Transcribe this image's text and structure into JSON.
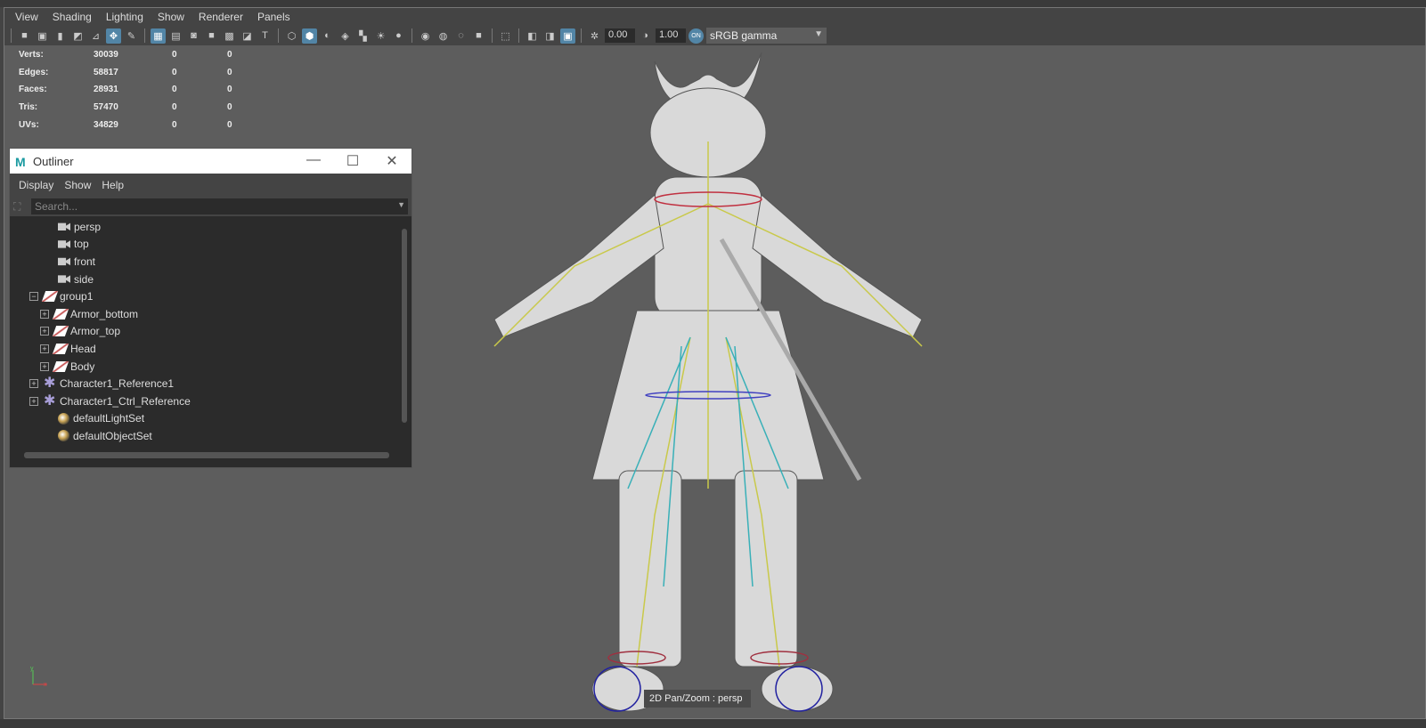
{
  "menubar": [
    "View",
    "Shading",
    "Lighting",
    "Show",
    "Renderer",
    "Panels"
  ],
  "toolbar": {
    "icons": [
      "camera-icon",
      "camera-attr-icon",
      "bookmark-icon",
      "image-plane-icon",
      "grid-snap-icon",
      "pan-zoom-icon",
      "grease-pencil-icon",
      "|",
      "grid-icon",
      "film-gate-icon",
      "resolution-gate-icon",
      "gate-mask-icon",
      "field-chart-icon",
      "safe-action-icon",
      "safe-title-icon",
      "|",
      "wireframe-icon",
      "smooth-shade-icon",
      "default-material-icon",
      "wireframe-on-shaded-icon",
      "textured-icon",
      "use-lights-icon",
      "shadows-icon",
      "|",
      "screen-space-ao-icon",
      "motion-blur-icon",
      "anti-aliasing-icon",
      "depth-of-field-icon",
      "|",
      "isolate-select-icon",
      "|",
      "xray-icon",
      "xray-joints-icon",
      "xray-active-icon",
      "|"
    ],
    "active": [
      "pan-zoom-icon",
      "grid-icon",
      "smooth-shade-icon",
      "xray-active-icon"
    ],
    "exposure": "0.00",
    "gamma": "1.00",
    "color_space": "sRGB gamma"
  },
  "stats": [
    {
      "label": "Verts:",
      "v": "30039",
      "a": "0",
      "b": "0"
    },
    {
      "label": "Edges:",
      "v": "58817",
      "a": "0",
      "b": "0"
    },
    {
      "label": "Faces:",
      "v": "28931",
      "a": "0",
      "b": "0"
    },
    {
      "label": "Tris:",
      "v": "57470",
      "a": "0",
      "b": "0"
    },
    {
      "label": "UVs:",
      "v": "34829",
      "a": "0",
      "b": "0"
    }
  ],
  "outliner": {
    "logo": "M",
    "title": "Outliner",
    "menu": [
      "Display",
      "Show",
      "Help"
    ],
    "search_placeholder": "Search...",
    "items": [
      {
        "label": "persp",
        "icon": "cam",
        "depth": 2,
        "exp": ""
      },
      {
        "label": "top",
        "icon": "cam",
        "depth": 2,
        "exp": ""
      },
      {
        "label": "front",
        "icon": "cam",
        "depth": 2,
        "exp": ""
      },
      {
        "label": "side",
        "icon": "cam",
        "depth": 2,
        "exp": ""
      },
      {
        "label": "group1",
        "icon": "grp",
        "depth": 1,
        "exp": "−"
      },
      {
        "label": "Armor_bottom",
        "icon": "grp",
        "depth": 2,
        "exp": "+"
      },
      {
        "label": "Armor_top",
        "icon": "grp",
        "depth": 2,
        "exp": "+"
      },
      {
        "label": "Head",
        "icon": "grp",
        "depth": 2,
        "exp": "+"
      },
      {
        "label": "Body",
        "icon": "grp",
        "depth": 2,
        "exp": "+"
      },
      {
        "label": "Character1_Reference1",
        "icon": "star",
        "depth": 1,
        "exp": "+"
      },
      {
        "label": "Character1_Ctrl_Reference",
        "icon": "star",
        "depth": 1,
        "exp": "+"
      },
      {
        "label": "defaultLightSet",
        "icon": "set",
        "depth": 2,
        "exp": ""
      },
      {
        "label": "defaultObjectSet",
        "icon": "set",
        "depth": 2,
        "exp": ""
      }
    ]
  },
  "hud": "2D Pan/Zoom : persp"
}
